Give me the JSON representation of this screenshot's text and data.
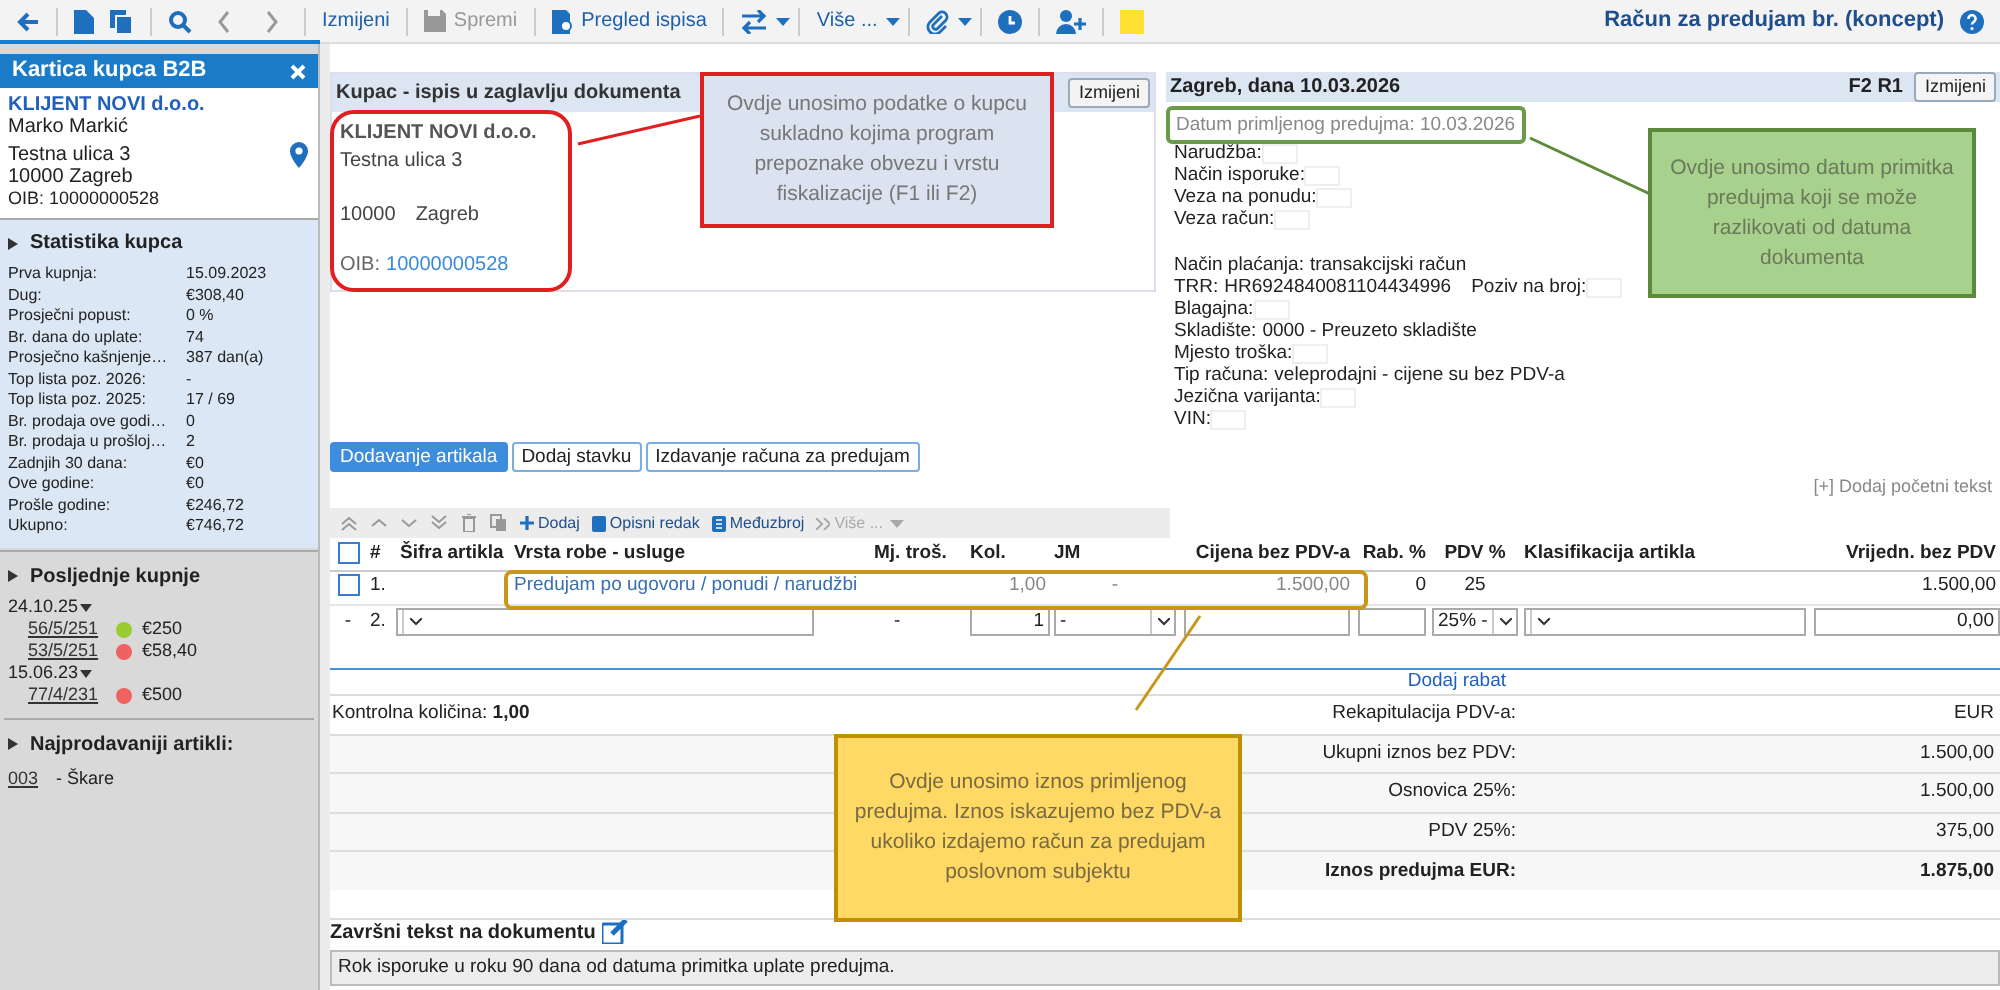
{
  "toolbar": {
    "buttons": [
      {
        "label": "Izmijeni",
        "disabled": false
      },
      {
        "label": "Spremi",
        "disabled": true
      },
      {
        "label": "Pregled ispisa",
        "disabled": false
      },
      {
        "label": "Više ...",
        "disabled": false
      }
    ],
    "title": "Račun za predujam br. (koncept)"
  },
  "sidebar": {
    "title": "Kartica kupca B2B",
    "customer": {
      "name": "KLIJENT NOVI d.o.o.",
      "contact": "Marko Markić",
      "street": "Testna ulica 3",
      "city": "10000 Zagreb",
      "oib": "OIB: 10000000528"
    },
    "stats": {
      "title": "Statistika kupca",
      "rows": [
        {
          "label": "Prva kupnja:",
          "value": "15.09.2023"
        },
        {
          "label": "Dug:",
          "value": "€308,40"
        },
        {
          "label": "Prosječni popust:",
          "value": "0 %"
        },
        {
          "label": "Br. dana do uplate:",
          "value": "74"
        },
        {
          "label": "Prosječno kašnjenje…",
          "value": "387 dan(a)"
        },
        {
          "label": "Top lista poz. 2026:",
          "value": "-"
        },
        {
          "label": "Top lista poz. 2025:",
          "value": "17 / 69"
        },
        {
          "label": "Br. prodaja ove godi…",
          "value": "0"
        },
        {
          "label": "Br. prodaja u prošloj…",
          "value": "2"
        },
        {
          "label": "Zadnjih 30 dana:",
          "value": "€0"
        },
        {
          "label": "Ove godine:",
          "value": "€0"
        },
        {
          "label": "Prošle godine:",
          "value": "€246,72"
        },
        {
          "label": "Ukupno:",
          "value": "€746,72"
        }
      ]
    },
    "recent": {
      "title": "Posljednje kupnje",
      "groups": [
        {
          "date": "24.10.25",
          "expanded": true,
          "items": [
            {
              "number": "56/5/251",
              "color": "#99cc33",
              "amount": "€250"
            },
            {
              "number": "53/5/251",
              "color": "#f06262",
              "amount": "€58,40"
            }
          ]
        },
        {
          "date": "15.06.23",
          "expanded": true,
          "items": [
            {
              "number": "77/4/231",
              "color": "#f06262",
              "amount": "€500"
            }
          ]
        }
      ]
    },
    "top": {
      "title": "Najprodavaniji artikli:",
      "items": [
        {
          "code": "003",
          "name": "- Škare"
        }
      ]
    }
  },
  "buyer": {
    "header": "Kupac - ispis u zaglavlju dokumenta",
    "button": "Izmijeni",
    "name": "KLIJENT NOVI d.o.o.",
    "street": "Testna ulica 3",
    "zip": "10000",
    "city": "Zagreb",
    "oib_label": "OIB:",
    "oib": "10000000528"
  },
  "document": {
    "header": "Zagreb, dana 10.03.2026",
    "type": "F2 R1",
    "button": "Izmijeni",
    "advance_date": "Datum primljenog predujma: 10.03.2026",
    "line_groups": [
      [
        {
          "label": "Narudžba:"
        },
        {
          "label": "Način isporuke:"
        },
        {
          "label": "Veza na ponudu:"
        },
        {
          "label": "Veza račun:"
        }
      ],
      [
        {
          "label": "Način plaćanja:",
          "value": "transakcijski račun"
        },
        {
          "label": "TRR:",
          "value": "HR6924840081104434996",
          "extra": "Poziv na broj:"
        },
        {
          "label": "Blagajna:"
        },
        {
          "label": "Skladište:",
          "value": "0000 - Preuzeto skladište"
        },
        {
          "label": "Mjesto troška:"
        },
        {
          "label": "Tip računa:",
          "value": "veleprodajni - cijene su bez PDV-a"
        },
        {
          "label": "Jezična varijanta:"
        },
        {
          "label": "VIN:"
        }
      ]
    ]
  },
  "tabs": [
    {
      "label": "Dodavanje artikala",
      "selected": true
    },
    {
      "label": "Dodaj stavku",
      "selected": false
    },
    {
      "label": "Izdavanje računa za predujam",
      "selected": false
    }
  ],
  "add_intro_link": "[+] Dodaj početni tekst",
  "table_toolbar": {
    "buttons": [
      {
        "label": "Dodaj",
        "disabled": false
      },
      {
        "label": "Opisni redak",
        "disabled": false
      },
      {
        "label": "Međuzbroj",
        "disabled": false
      },
      {
        "label": "Više ...",
        "disabled": true
      }
    ]
  },
  "table": {
    "select_all_checked": false,
    "columns": [
      "#",
      "Šifra artikla",
      "Vrsta robe - usluge",
      "Mj. troš.",
      "Kol.",
      "JM",
      "Cijena bez PDV-a",
      "Rab. %",
      "PDV %",
      "Klasifikacija artikla",
      "Vrijedn. bez PDV"
    ],
    "rows": [
      {
        "kind": "item",
        "checked": false,
        "number": "1.",
        "code": "",
        "description": "Predujam po ugovoru / ponudi / narudžbi",
        "cost_center": "",
        "quantity": "1,00",
        "unit": "-",
        "price": "1.500,00",
        "discount": "0",
        "vat": "25",
        "classification": "",
        "value": "1.500,00"
      },
      {
        "kind": "input",
        "marker": "-",
        "number": "2.",
        "cost_center": "-",
        "quantity": "1",
        "unit": "-",
        "vat": "25% -",
        "value": "0,00"
      }
    ]
  },
  "discount_link": "Dodaj rabat",
  "summary": {
    "control_quantity": "Kontrolna količina: **1,00**",
    "rows": [
      {
        "label": "Rekapitulacija PDV-a:",
        "value": "EUR",
        "total": false
      },
      {
        "label": "Ukupni iznos bez PDV:",
        "value": "1.500,00",
        "total": false
      },
      {
        "label": "Osnovica 25%:",
        "value": "1.500,00",
        "total": false
      },
      {
        "label": "PDV 25%:",
        "value": "375,00",
        "total": false
      },
      {
        "label": "Iznos predujma EUR:",
        "value": "1.875,00",
        "total": true
      }
    ]
  },
  "closing": {
    "title": "Završni tekst na dokumentu",
    "text": "Rok isporuke u roku 90 dana od datuma primitka uplate predujma."
  },
  "callouts": [
    {
      "kind": "blue",
      "text": "Ovdje unosimo podatke o kupcu sukladno kojima program prepoznake obvezu i vrstu fiskalizacije (F1 ili F2)"
    },
    {
      "kind": "green",
      "text": "Ovdje unosimo datum primitka predujma koji se može razlikovati od datuma dokumenta"
    },
    {
      "kind": "yellow",
      "text": "Ovdje unosimo iznos primljenog predujma. Iznos iskazujemo bez PDV-a ukoliko izdajemo račun za predujam poslovnom subjektu"
    }
  ]
}
